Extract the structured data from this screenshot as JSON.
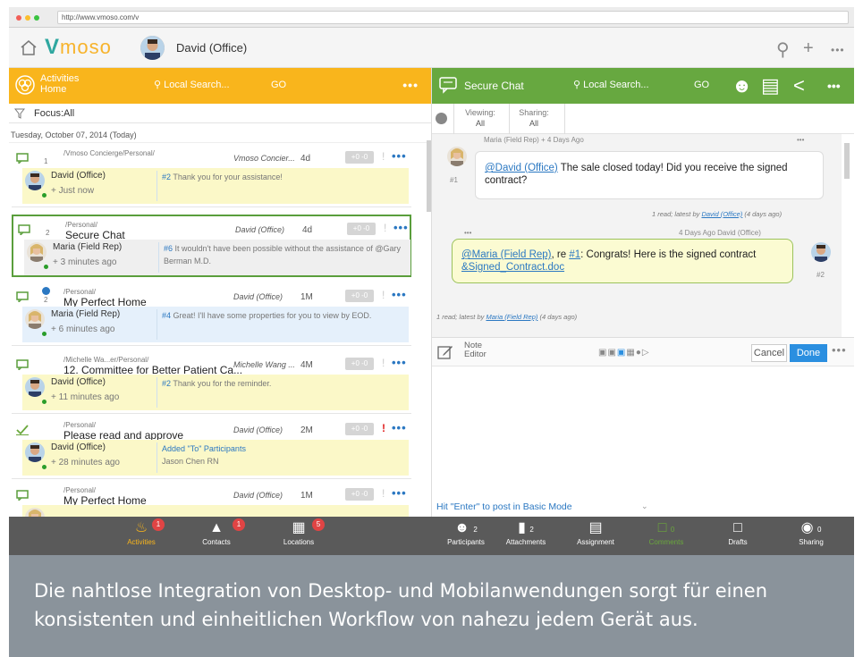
{
  "browser": {
    "url": "http://www.vmoso.com/v"
  },
  "app": {
    "logo_v": "V",
    "logo_rest": "moso",
    "current_user": "David (Office)"
  },
  "left": {
    "panel_title_line1": "Activities",
    "panel_title_line2": "Home",
    "search_placeholder": "Local Search...",
    "go_label": "GO",
    "more": "•••",
    "focus": "Focus:All",
    "date": "Tuesday, October 07, 2014 (Today)",
    "cards": [
      {
        "num": "1",
        "path": "/Vmoso Concierge/Personal/",
        "title": "",
        "owner": "Vmoso Concier...",
        "time": "4d",
        "votes": "+0 -0",
        "author": "David (Office)",
        "ago": "+ Just now",
        "ref": "#2",
        "msg": "Thank you for your assistance!"
      },
      {
        "num": "2",
        "path": "/Personal/",
        "title": "Secure Chat",
        "owner": "David (Office)",
        "time": "4d",
        "votes": "+0 -0",
        "author": "Maria (Field Rep)",
        "ago": "+ 3 minutes ago",
        "ref": "#6",
        "msg": "It wouldn't have been possible without the assistance of @Gary Berman M.D."
      },
      {
        "num": "2",
        "path": "/Personal/",
        "title": "My Perfect Home",
        "owner": "David (Office)",
        "time": "1M",
        "votes": "+0 -0",
        "author": "Maria (Field Rep)",
        "ago": "+ 6 minutes ago",
        "ref": "#4",
        "msg": "Great! I'll have some properties for you to view by EOD."
      },
      {
        "num": "",
        "path": "/Michelle Wa...er/Personal/",
        "title": "12. Committee for Better Patient Ca...",
        "owner": "Michelle Wang ...",
        "time": "4M",
        "votes": "+0 -0",
        "author": "David (Office)",
        "ago": "+ 11 minutes ago",
        "ref": "#2",
        "msg": "Thank you for the reminder."
      },
      {
        "num": "",
        "path": "/Personal/",
        "title": "Please read and approve",
        "owner": "David (Office)",
        "time": "2M",
        "votes": "+0 -0",
        "author": "David (Office)",
        "ago": "+ 28 minutes ago",
        "ref": "",
        "msg": "Added \"To\" Participants",
        "msg2": "Jason Chen RN"
      },
      {
        "num": "",
        "path": "/Personal/",
        "title": "My Perfect Home",
        "owner": "David (Office)",
        "time": "1M",
        "votes": "+0 -0",
        "author": "",
        "ago": "",
        "ref": "",
        "msg": ""
      }
    ],
    "bottom": [
      {
        "label": "Activities",
        "badge": "1"
      },
      {
        "label": "Contacts",
        "badge": "1"
      },
      {
        "label": "Locations",
        "badge": "5"
      }
    ]
  },
  "right": {
    "panel_title": "Secure Chat",
    "search_placeholder": "Local Search...",
    "go_label": "GO",
    "viewing_label": "Viewing:",
    "viewing_value": "All",
    "sharing_label": "Sharing:",
    "sharing_value": "All",
    "msg1": {
      "meta": "Maria (Field Rep)  + 4 Days Ago",
      "num": "#1",
      "mention": "@David (Office)",
      "text": " The sale closed today! Did you receive the signed contract?",
      "read_prefix": "1 read; latest by ",
      "read_user": "David (Office)",
      "read_suffix": " (4 days ago)"
    },
    "msg2": {
      "meta": "4 Days Ago  David (Office)",
      "num": "#2",
      "mention": "@Maria (Field Rep)",
      "text_mid": ", re ",
      "ref": "#1",
      "text": ": Congrats! Here is the signed contract",
      "attachment": "&Signed_Contract.doc",
      "read_prefix": "1 read; latest by ",
      "read_user": "Maria (Field Rep)",
      "read_suffix": " (4 days ago)"
    },
    "editor": {
      "label_line1": "Note",
      "label_line2": "Editor",
      "cancel": "Cancel",
      "done": "Done",
      "hint": "Hit \"Enter\" to post in Basic Mode"
    },
    "bottom": [
      {
        "label": "Participants",
        "count": "2"
      },
      {
        "label": "Attachments",
        "count": "2"
      },
      {
        "label": "Assignment",
        "count": ""
      },
      {
        "label": "Comments",
        "count": "0"
      },
      {
        "label": "Drafts",
        "count": ""
      },
      {
        "label": "Sharing",
        "count": "0"
      }
    ]
  },
  "caption": "Die nahtlose Integration von Desktop- und Mobilanwendungen sorgt für einen konsistenten und einheitlichen Workflow von nahezu jedem Gerät aus."
}
